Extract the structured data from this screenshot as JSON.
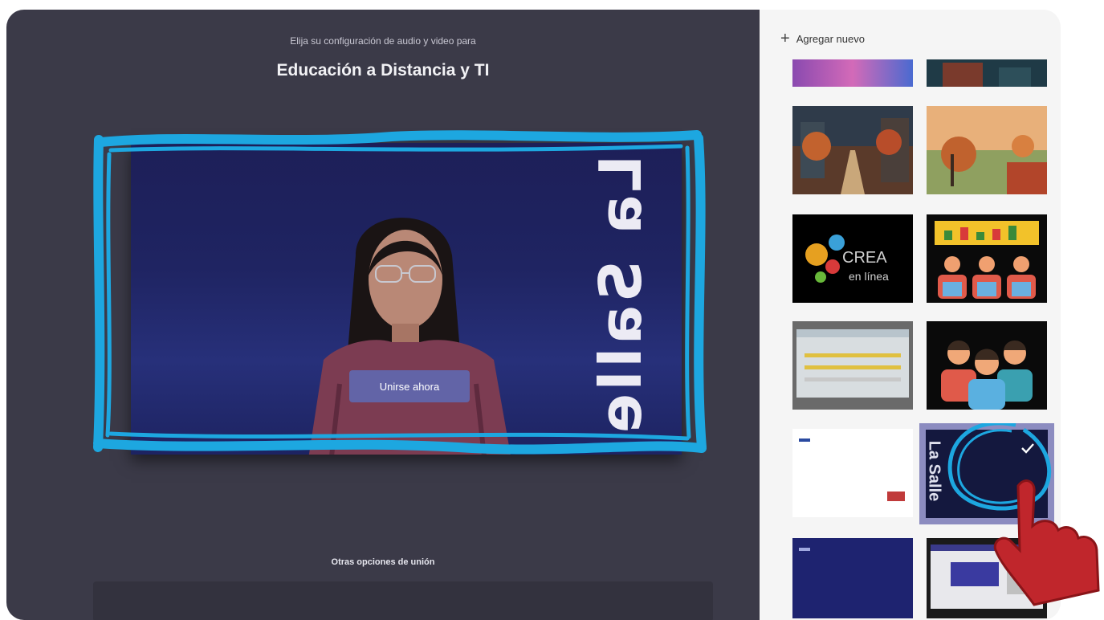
{
  "header": {
    "subtitle": "Elija su configuración de audio y video para",
    "title": "Educación a Distancia y TI"
  },
  "preview": {
    "join_label": "Unirse ahora",
    "background_text": "La Salle"
  },
  "other_options": {
    "label": "Otras opciones de unión"
  },
  "background_panel": {
    "add_label": "Agregar nuevo",
    "thumbnails": [
      {
        "name": "abstract-purple"
      },
      {
        "name": "forest-dark"
      },
      {
        "name": "autumn-street"
      },
      {
        "name": "autumn-landscape"
      },
      {
        "name": "crea-en-linea",
        "text1": "CREA",
        "text2": "en línea"
      },
      {
        "name": "classroom-icons"
      },
      {
        "name": "spreadsheet-photo"
      },
      {
        "name": "people-icons"
      },
      {
        "name": "white-slide"
      },
      {
        "name": "la-salle-blue",
        "text": "La Salle",
        "selected": true
      },
      {
        "name": "blue-slide"
      },
      {
        "name": "screenshot-desktop"
      }
    ]
  },
  "colors": {
    "main_bg": "#3b3a48",
    "accent": "#6264a7",
    "highlight_stroke": "#1da7e0",
    "hand": "#c0262c"
  }
}
